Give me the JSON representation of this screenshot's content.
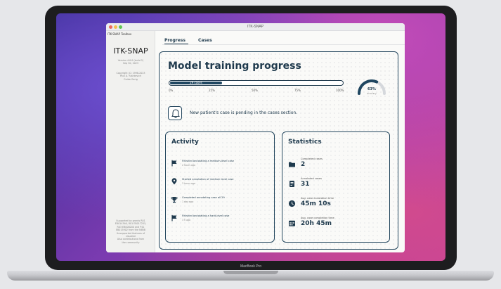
{
  "device": {
    "brand": "MacBook Pro"
  },
  "window": {
    "title": "ITK-SNAP"
  },
  "sidebar": {
    "toolbar": "ITK-SNAP Toolbox",
    "logo": "ITK-SNAP",
    "version_lines": [
      "Version 4.0.0 (build 2)",
      "Sep 30, 2023"
    ],
    "copyright_lines": [
      "Copyright (C) 1998-2023",
      "Paul A. Yushkevich",
      "Guido Gerig"
    ],
    "support_lines": [
      "Supported by grants R01",
      "EB014346, R01 EB017255,",
      "R03 EB008200 and P41",
      "EB015902 from the NIBIB",
      "Unsupported features of",
      "visualize",
      "Also contributions from",
      "the community"
    ]
  },
  "tabs": [
    {
      "label": "Progress"
    },
    {
      "label": "Cases"
    }
  ],
  "progress": {
    "title": "Model training progress",
    "bar_label": "29 cases",
    "bar_fraction": 0.3,
    "ticks": [
      "0%",
      "25%",
      "50%",
      "75%",
      "100%"
    ],
    "accuracy_value": "63%",
    "accuracy_label": "accuracy",
    "accuracy_fraction": 0.63
  },
  "notice": {
    "text": "New patient's case is pending in the cases section."
  },
  "activity": {
    "title": "Activity",
    "items": [
      {
        "icon": "flag-icon",
        "title": "Finished annotating a medium-level case",
        "time": "2 hours ago"
      },
      {
        "icon": "location-pin-icon",
        "title": "Started annotation of medium level case",
        "time": "3 hours ago"
      },
      {
        "icon": "trophy-icon",
        "title": "Completed annotating case all 29",
        "time": "1 day ago"
      },
      {
        "icon": "flag-icon",
        "title": "Finished annotating a hard-level case",
        "time": "3 h ago"
      }
    ]
  },
  "statistics": {
    "title": "Statistics",
    "items": [
      {
        "icon": "folder-icon",
        "label": "Completed cases",
        "value": "2"
      },
      {
        "icon": "document-icon",
        "label": "Annotated cases",
        "value": "31"
      },
      {
        "icon": "clock-icon",
        "label": "Avg. case annotation time",
        "value": "45m 10s"
      },
      {
        "icon": "calendar-icon",
        "label": "Avg. case completion time",
        "value": "20h 45m"
      }
    ]
  },
  "colors": {
    "accent": "#1f3a4d",
    "panel_border": "#24475e",
    "bar_fill": "#1f4660"
  }
}
